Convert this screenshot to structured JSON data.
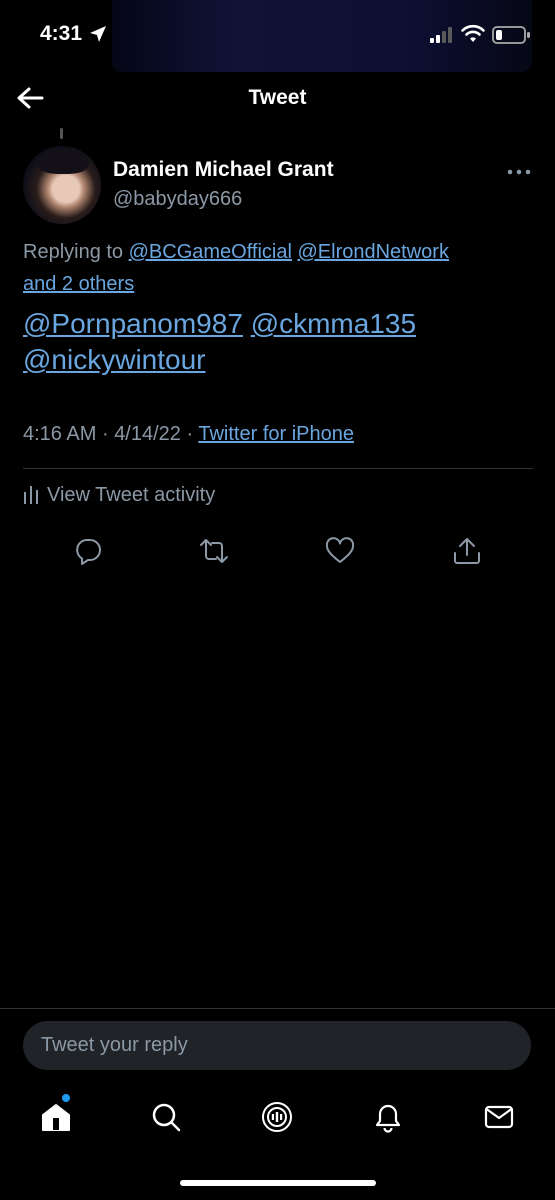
{
  "status_bar": {
    "time": "4:31"
  },
  "header": {
    "title": "Tweet"
  },
  "tweet": {
    "author_name": "Damien Michael Grant",
    "author_handle": "@babyday666",
    "replying_prefix": "Replying to",
    "replying_to": [
      "@BCGameOfficial",
      "@ElrondNetwork"
    ],
    "replying_others": "and 2 others",
    "mentions": [
      "@Pornpanom987",
      "@ckmma135",
      "@nickywintour"
    ],
    "time": "4:16 AM",
    "date": "4/14/22",
    "source": "Twitter for iPhone",
    "activity_label": "View Tweet activity"
  },
  "reply": {
    "placeholder": "Tweet your reply"
  },
  "icons": {
    "back": "back-arrow-icon",
    "more": "more-icon",
    "reply": "reply-icon",
    "retweet": "retweet-icon",
    "like": "heart-icon",
    "share": "share-icon",
    "tabs": [
      "home-icon",
      "search-icon",
      "spaces-icon",
      "notifications-icon",
      "messages-icon"
    ]
  },
  "colors": {
    "link": "#6aa6df",
    "accent": "#1d9bf0",
    "muted": "#8b98a5",
    "background": "#000000"
  }
}
